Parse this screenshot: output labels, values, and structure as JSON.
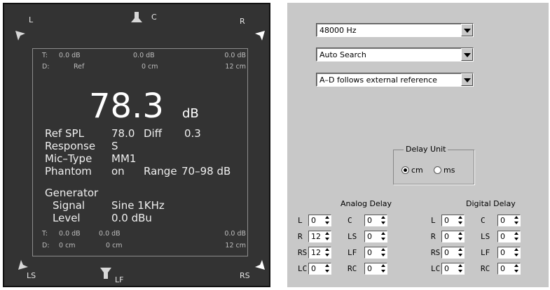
{
  "meter": {
    "corners": {
      "l": "L",
      "c": "C",
      "r": "R",
      "ls": "LS",
      "lf": "LF",
      "rs": "RS"
    },
    "top_rows": {
      "t_label": "T:",
      "d_label": "D:",
      "t_values": [
        "0.0 dB",
        "0.0 dB",
        "0.0 dB"
      ],
      "d_values": [
        "Ref",
        "0 cm",
        "12 cm"
      ]
    },
    "reading": {
      "value": "78.3",
      "unit": "dB"
    },
    "info": {
      "ref_spl_label": "Ref SPL",
      "ref_spl_value": "78.0",
      "diff_label": "Diff",
      "diff_value": "0.3",
      "response_label": "Response",
      "response_value": "S",
      "mic_type_label": "Mic–Type",
      "mic_type_value": "MM1",
      "phantom_label": "Phantom",
      "phantom_value": "on",
      "range_label": "Range",
      "range_value": "70–98 dB"
    },
    "generator": {
      "title": "Generator",
      "signal_label": "Signal",
      "signal_value": "Sine 1KHz",
      "level_label": "Level",
      "level_value": "0.0 dBu"
    },
    "bottom_rows": {
      "t_label": "T:",
      "d_label": "D:",
      "t_values": [
        "0.0 dB",
        "0.0 dB",
        "0.0 dB"
      ],
      "d_values": [
        "0 cm",
        "0 cm",
        "12 cm"
      ]
    }
  },
  "settings": {
    "sample_rate": "48000 Hz",
    "sync_mode": "Auto Search",
    "ad_reference": "A–D follows external reference",
    "delay_unit": {
      "title": "Delay Unit",
      "options": [
        "cm",
        "ms"
      ],
      "selected": "cm"
    },
    "analog_delay": {
      "title": "Analog Delay",
      "channels": [
        {
          "label": "L",
          "value": "0"
        },
        {
          "label": "C",
          "value": "0"
        },
        {
          "label": "R",
          "value": "12"
        },
        {
          "label": "LS",
          "value": "0"
        },
        {
          "label": "RS",
          "value": "12"
        },
        {
          "label": "LF",
          "value": "0"
        },
        {
          "label": "LC",
          "value": "0"
        },
        {
          "label": "RC",
          "value": "0"
        }
      ]
    },
    "digital_delay": {
      "title": "Digital Delay",
      "channels": [
        {
          "label": "L",
          "value": "0"
        },
        {
          "label": "C",
          "value": "0"
        },
        {
          "label": "R",
          "value": "0"
        },
        {
          "label": "LS",
          "value": "0"
        },
        {
          "label": "RS",
          "value": "0"
        },
        {
          "label": "LF",
          "value": "0"
        },
        {
          "label": "LC",
          "value": "0"
        },
        {
          "label": "RC",
          "value": "0"
        }
      ]
    }
  }
}
